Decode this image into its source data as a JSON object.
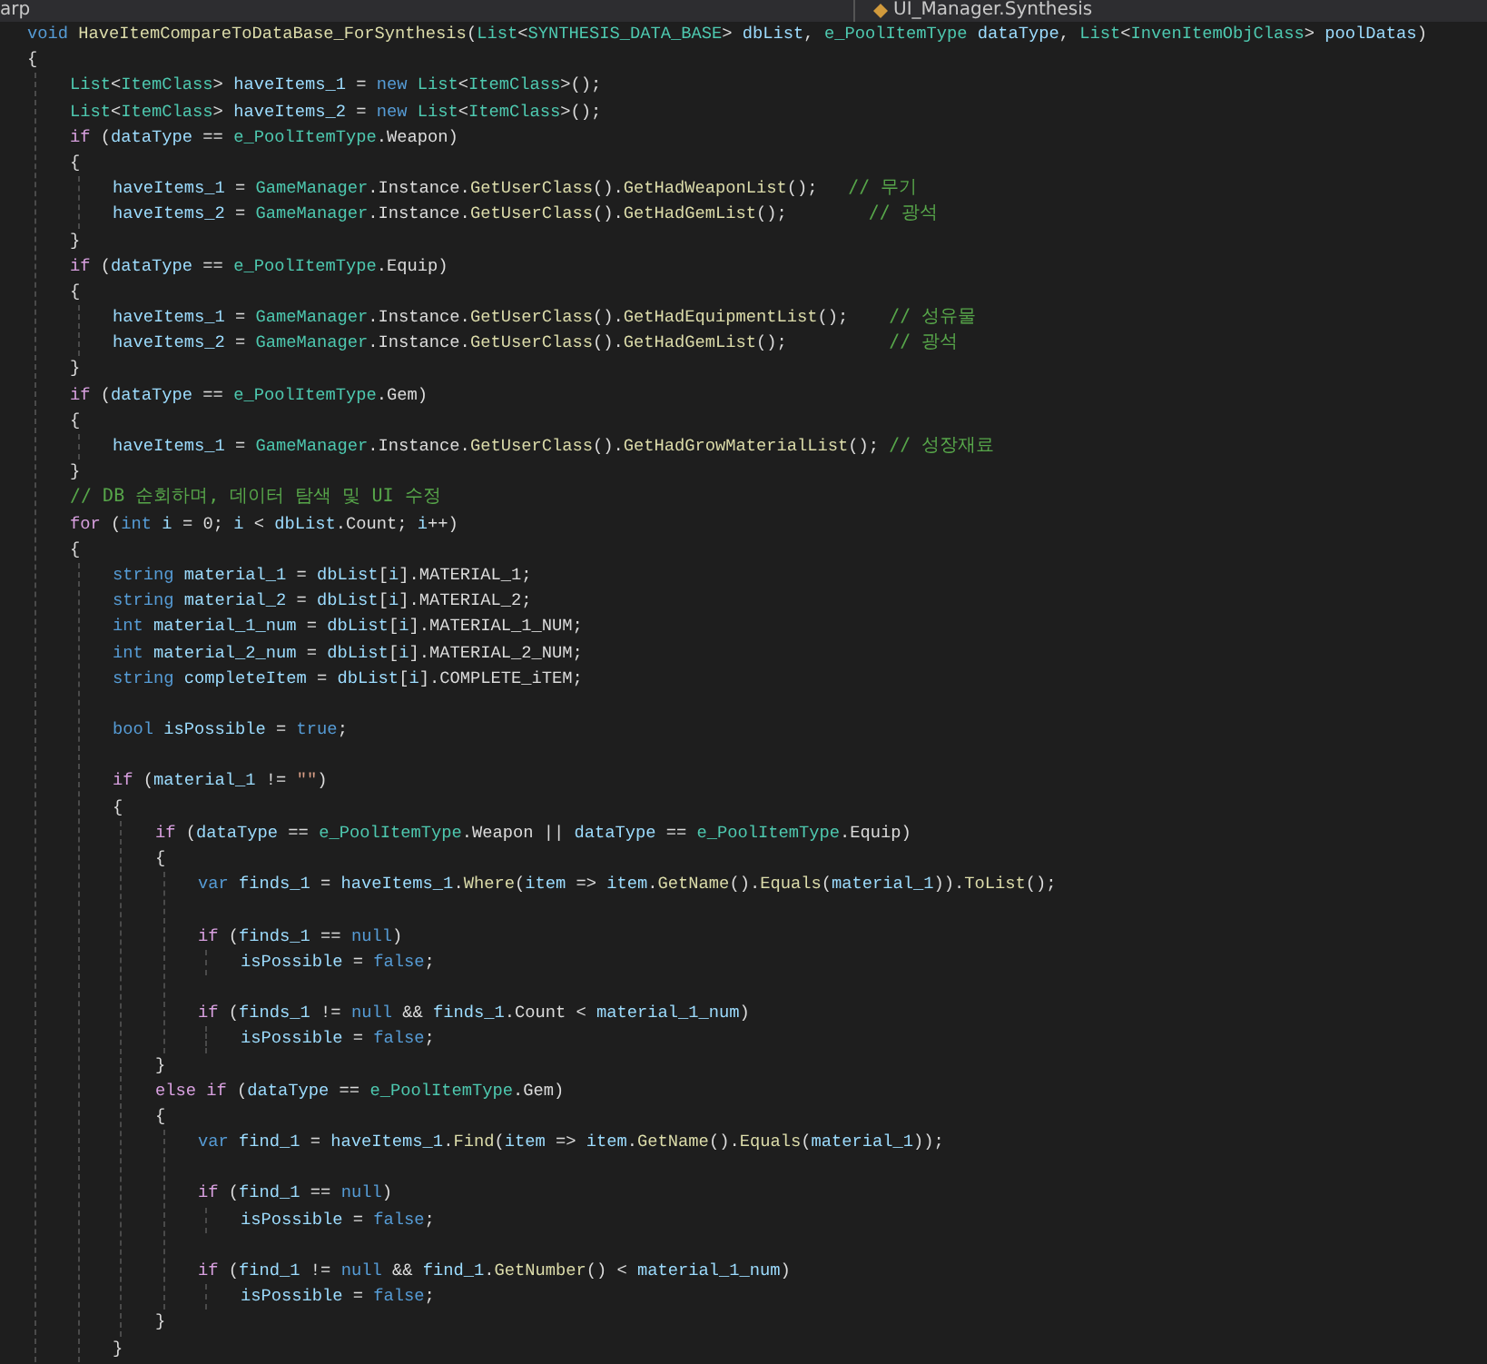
{
  "nav_bar": {
    "project": "arp",
    "member": "UI_Manager.Synthesis"
  },
  "code": [
    {
      "kind": "code",
      "tokens": [
        {
          "kind": "kw",
          "text": "void "
        },
        {
          "kind": "fn",
          "text": "HaveItemCompareToDataBase_ForSynthesis"
        },
        {
          "kind": "txt",
          "text": "("
        },
        {
          "kind": "type",
          "text": "List"
        },
        {
          "kind": "txt",
          "text": "<"
        },
        {
          "kind": "type",
          "text": "SYNTHESIS_DATA_BASE"
        },
        {
          "kind": "txt",
          "text": "> "
        },
        {
          "kind": "var",
          "text": "dbList"
        },
        {
          "kind": "txt",
          "text": ", "
        },
        {
          "kind": "type",
          "text": "e_PoolItemType "
        },
        {
          "kind": "var",
          "text": "dataType"
        },
        {
          "kind": "txt",
          "text": ", "
        },
        {
          "kind": "type",
          "text": "List"
        },
        {
          "kind": "txt",
          "text": "<"
        },
        {
          "kind": "type",
          "text": "InvenItemObjClass"
        },
        {
          "kind": "txt",
          "text": "> "
        },
        {
          "kind": "var",
          "text": "poolDatas"
        },
        {
          "kind": "txt",
          "text": ")"
        }
      ]
    },
    {
      "kind": "code",
      "tokens": [
        {
          "kind": "txt",
          "text": "{"
        }
      ],
      "children": [
        {
          "kind": "code",
          "tokens": [
            {
              "kind": "type",
              "text": "List"
            },
            {
              "kind": "txt",
              "text": "<"
            },
            {
              "kind": "type",
              "text": "ItemClass"
            },
            {
              "kind": "txt",
              "text": "> "
            },
            {
              "kind": "var",
              "text": "haveItems_1"
            },
            {
              "kind": "txt",
              "text": " = "
            },
            {
              "kind": "kw",
              "text": "new "
            },
            {
              "kind": "type",
              "text": "List"
            },
            {
              "kind": "txt",
              "text": "<"
            },
            {
              "kind": "type",
              "text": "ItemClass"
            },
            {
              "kind": "txt",
              "text": ">();"
            }
          ]
        },
        {
          "kind": "code",
          "tokens": [
            {
              "kind": "type",
              "text": "List"
            },
            {
              "kind": "txt",
              "text": "<"
            },
            {
              "kind": "type",
              "text": "ItemClass"
            },
            {
              "kind": "txt",
              "text": "> "
            },
            {
              "kind": "var",
              "text": "haveItems_2"
            },
            {
              "kind": "txt",
              "text": " = "
            },
            {
              "kind": "kw",
              "text": "new "
            },
            {
              "kind": "type",
              "text": "List"
            },
            {
              "kind": "txt",
              "text": "<"
            },
            {
              "kind": "type",
              "text": "ItemClass"
            },
            {
              "kind": "txt",
              "text": ">();"
            }
          ]
        },
        {
          "kind": "code",
          "tokens": [
            {
              "kind": "ctl",
              "text": "if "
            },
            {
              "kind": "txt",
              "text": "("
            },
            {
              "kind": "var",
              "text": "dataType"
            },
            {
              "kind": "txt",
              "text": " == "
            },
            {
              "kind": "type",
              "text": "e_PoolItemType"
            },
            {
              "kind": "txt",
              "text": ".Weapon)"
            }
          ]
        },
        {
          "kind": "code",
          "tokens": [
            {
              "kind": "txt",
              "text": "{"
            }
          ],
          "children": [
            {
              "kind": "code",
              "tokens": [
                {
                  "kind": "var",
                  "text": "haveItems_1"
                },
                {
                  "kind": "txt",
                  "text": " = "
                },
                {
                  "kind": "type",
                  "text": "GameManager"
                },
                {
                  "kind": "txt",
                  "text": ".Instance."
                },
                {
                  "kind": "fn",
                  "text": "GetUserClass"
                },
                {
                  "kind": "txt",
                  "text": "()."
                },
                {
                  "kind": "fn",
                  "text": "GetHadWeaponList"
                },
                {
                  "kind": "txt",
                  "text": "();   "
                },
                {
                  "kind": "cmt",
                  "text": "// 무기"
                }
              ]
            },
            {
              "kind": "code",
              "tokens": [
                {
                  "kind": "var",
                  "text": "haveItems_2"
                },
                {
                  "kind": "txt",
                  "text": " = "
                },
                {
                  "kind": "type",
                  "text": "GameManager"
                },
                {
                  "kind": "txt",
                  "text": ".Instance."
                },
                {
                  "kind": "fn",
                  "text": "GetUserClass"
                },
                {
                  "kind": "txt",
                  "text": "()."
                },
                {
                  "kind": "fn",
                  "text": "GetHadGemList"
                },
                {
                  "kind": "txt",
                  "text": "();        "
                },
                {
                  "kind": "cmt",
                  "text": "// 광석"
                }
              ]
            }
          ]
        },
        {
          "kind": "code",
          "tokens": [
            {
              "kind": "txt",
              "text": "}"
            }
          ]
        },
        {
          "kind": "code",
          "tokens": [
            {
              "kind": "ctl",
              "text": "if "
            },
            {
              "kind": "txt",
              "text": "("
            },
            {
              "kind": "var",
              "text": "dataType"
            },
            {
              "kind": "txt",
              "text": " == "
            },
            {
              "kind": "type",
              "text": "e_PoolItemType"
            },
            {
              "kind": "txt",
              "text": ".Equip)"
            }
          ]
        },
        {
          "kind": "code",
          "tokens": [
            {
              "kind": "txt",
              "text": "{"
            }
          ],
          "children": [
            {
              "kind": "code",
              "tokens": [
                {
                  "kind": "var",
                  "text": "haveItems_1"
                },
                {
                  "kind": "txt",
                  "text": " = "
                },
                {
                  "kind": "type",
                  "text": "GameManager"
                },
                {
                  "kind": "txt",
                  "text": ".Instance."
                },
                {
                  "kind": "fn",
                  "text": "GetUserClass"
                },
                {
                  "kind": "txt",
                  "text": "()."
                },
                {
                  "kind": "fn",
                  "text": "GetHadEquipmentList"
                },
                {
                  "kind": "txt",
                  "text": "();    "
                },
                {
                  "kind": "cmt",
                  "text": "// 성유물"
                }
              ]
            },
            {
              "kind": "code",
              "tokens": [
                {
                  "kind": "var",
                  "text": "haveItems_2"
                },
                {
                  "kind": "txt",
                  "text": " = "
                },
                {
                  "kind": "type",
                  "text": "GameManager"
                },
                {
                  "kind": "txt",
                  "text": ".Instance."
                },
                {
                  "kind": "fn",
                  "text": "GetUserClass"
                },
                {
                  "kind": "txt",
                  "text": "()."
                },
                {
                  "kind": "fn",
                  "text": "GetHadGemList"
                },
                {
                  "kind": "txt",
                  "text": "();          "
                },
                {
                  "kind": "cmt",
                  "text": "// 광석"
                }
              ]
            }
          ]
        },
        {
          "kind": "code",
          "tokens": [
            {
              "kind": "txt",
              "text": "}"
            }
          ]
        },
        {
          "kind": "code",
          "tokens": [
            {
              "kind": "ctl",
              "text": "if "
            },
            {
              "kind": "txt",
              "text": "("
            },
            {
              "kind": "var",
              "text": "dataType"
            },
            {
              "kind": "txt",
              "text": " == "
            },
            {
              "kind": "type",
              "text": "e_PoolItemType"
            },
            {
              "kind": "txt",
              "text": ".Gem)"
            }
          ]
        },
        {
          "kind": "code",
          "tokens": [
            {
              "kind": "txt",
              "text": "{"
            }
          ],
          "children": [
            {
              "kind": "code",
              "tokens": [
                {
                  "kind": "var",
                  "text": "haveItems_1"
                },
                {
                  "kind": "txt",
                  "text": " = "
                },
                {
                  "kind": "type",
                  "text": "GameManager"
                },
                {
                  "kind": "txt",
                  "text": ".Instance."
                },
                {
                  "kind": "fn",
                  "text": "GetUserClass"
                },
                {
                  "kind": "txt",
                  "text": "()."
                },
                {
                  "kind": "fn",
                  "text": "GetHadGrowMaterialList"
                },
                {
                  "kind": "txt",
                  "text": "(); "
                },
                {
                  "kind": "cmt",
                  "text": "// 성장재료"
                }
              ]
            }
          ]
        },
        {
          "kind": "code",
          "tokens": [
            {
              "kind": "txt",
              "text": "}"
            }
          ]
        },
        {
          "kind": "code",
          "tokens": [
            {
              "kind": "cmt",
              "text": "// DB 순회하며, 데이터 탐색 및 UI 수정"
            }
          ]
        },
        {
          "kind": "code",
          "tokens": [
            {
              "kind": "ctl",
              "text": "for "
            },
            {
              "kind": "txt",
              "text": "("
            },
            {
              "kind": "kw",
              "text": "int "
            },
            {
              "kind": "var",
              "text": "i"
            },
            {
              "kind": "txt",
              "text": " = 0; "
            },
            {
              "kind": "var",
              "text": "i"
            },
            {
              "kind": "txt",
              "text": " < "
            },
            {
              "kind": "var",
              "text": "dbList"
            },
            {
              "kind": "txt",
              "text": ".Count; "
            },
            {
              "kind": "var",
              "text": "i"
            },
            {
              "kind": "txt",
              "text": "++)"
            }
          ]
        },
        {
          "kind": "code",
          "tokens": [
            {
              "kind": "txt",
              "text": "{"
            }
          ],
          "children": [
            {
              "kind": "code",
              "tokens": [
                {
                  "kind": "kw",
                  "text": "string "
                },
                {
                  "kind": "var",
                  "text": "material_1"
                },
                {
                  "kind": "txt",
                  "text": " = "
                },
                {
                  "kind": "var",
                  "text": "dbList"
                },
                {
                  "kind": "txt",
                  "text": "["
                },
                {
                  "kind": "var",
                  "text": "i"
                },
                {
                  "kind": "txt",
                  "text": "].MATERIAL_1;"
                }
              ]
            },
            {
              "kind": "code",
              "tokens": [
                {
                  "kind": "kw",
                  "text": "string "
                },
                {
                  "kind": "var",
                  "text": "material_2"
                },
                {
                  "kind": "txt",
                  "text": " = "
                },
                {
                  "kind": "var",
                  "text": "dbList"
                },
                {
                  "kind": "txt",
                  "text": "["
                },
                {
                  "kind": "var",
                  "text": "i"
                },
                {
                  "kind": "txt",
                  "text": "].MATERIAL_2;"
                }
              ]
            },
            {
              "kind": "code",
              "tokens": [
                {
                  "kind": "kw",
                  "text": "int "
                },
                {
                  "kind": "var",
                  "text": "material_1_num"
                },
                {
                  "kind": "txt",
                  "text": " = "
                },
                {
                  "kind": "var",
                  "text": "dbList"
                },
                {
                  "kind": "txt",
                  "text": "["
                },
                {
                  "kind": "var",
                  "text": "i"
                },
                {
                  "kind": "txt",
                  "text": "].MATERIAL_1_NUM;"
                }
              ]
            },
            {
              "kind": "code",
              "tokens": [
                {
                  "kind": "kw",
                  "text": "int "
                },
                {
                  "kind": "var",
                  "text": "material_2_num"
                },
                {
                  "kind": "txt",
                  "text": " = "
                },
                {
                  "kind": "var",
                  "text": "dbList"
                },
                {
                  "kind": "txt",
                  "text": "["
                },
                {
                  "kind": "var",
                  "text": "i"
                },
                {
                  "kind": "txt",
                  "text": "].MATERIAL_2_NUM;"
                }
              ]
            },
            {
              "kind": "code",
              "tokens": [
                {
                  "kind": "kw",
                  "text": "string "
                },
                {
                  "kind": "var",
                  "text": "completeItem"
                },
                {
                  "kind": "txt",
                  "text": " = "
                },
                {
                  "kind": "var",
                  "text": "dbList"
                },
                {
                  "kind": "txt",
                  "text": "["
                },
                {
                  "kind": "var",
                  "text": "i"
                },
                {
                  "kind": "txt",
                  "text": "].COMPLETE_iTEM;"
                }
              ]
            },
            {
              "kind": "blank"
            },
            {
              "kind": "code",
              "tokens": [
                {
                  "kind": "kw",
                  "text": "bool "
                },
                {
                  "kind": "var",
                  "text": "isPossible"
                },
                {
                  "kind": "txt",
                  "text": " = "
                },
                {
                  "kind": "kw",
                  "text": "true"
                },
                {
                  "kind": "txt",
                  "text": ";"
                }
              ]
            },
            {
              "kind": "blank"
            },
            {
              "kind": "code",
              "tokens": [
                {
                  "kind": "ctl",
                  "text": "if "
                },
                {
                  "kind": "txt",
                  "text": "("
                },
                {
                  "kind": "var",
                  "text": "material_1"
                },
                {
                  "kind": "txt",
                  "text": " != "
                },
                {
                  "kind": "str",
                  "text": "\"\""
                },
                {
                  "kind": "txt",
                  "text": ")"
                }
              ]
            },
            {
              "kind": "code",
              "tokens": [
                {
                  "kind": "txt",
                  "text": "{"
                }
              ],
              "children": [
                {
                  "kind": "code",
                  "tokens": [
                    {
                      "kind": "ctl",
                      "text": "if "
                    },
                    {
                      "kind": "txt",
                      "text": "("
                    },
                    {
                      "kind": "var",
                      "text": "dataType"
                    },
                    {
                      "kind": "txt",
                      "text": " == "
                    },
                    {
                      "kind": "type",
                      "text": "e_PoolItemType"
                    },
                    {
                      "kind": "txt",
                      "text": ".Weapon || "
                    },
                    {
                      "kind": "var",
                      "text": "dataType"
                    },
                    {
                      "kind": "txt",
                      "text": " == "
                    },
                    {
                      "kind": "type",
                      "text": "e_PoolItemType"
                    },
                    {
                      "kind": "txt",
                      "text": ".Equip)"
                    }
                  ]
                },
                {
                  "kind": "code",
                  "tokens": [
                    {
                      "kind": "txt",
                      "text": "{"
                    }
                  ],
                  "children": [
                    {
                      "kind": "code",
                      "tokens": [
                        {
                          "kind": "kw",
                          "text": "var "
                        },
                        {
                          "kind": "var",
                          "text": "finds_1"
                        },
                        {
                          "kind": "txt",
                          "text": " = "
                        },
                        {
                          "kind": "var",
                          "text": "haveItems_1"
                        },
                        {
                          "kind": "txt",
                          "text": "."
                        },
                        {
                          "kind": "fn",
                          "text": "Where"
                        },
                        {
                          "kind": "txt",
                          "text": "("
                        },
                        {
                          "kind": "var",
                          "text": "item"
                        },
                        {
                          "kind": "txt",
                          "text": " => "
                        },
                        {
                          "kind": "var",
                          "text": "item"
                        },
                        {
                          "kind": "txt",
                          "text": "."
                        },
                        {
                          "kind": "fn",
                          "text": "GetName"
                        },
                        {
                          "kind": "txt",
                          "text": "()."
                        },
                        {
                          "kind": "fn",
                          "text": "Equals"
                        },
                        {
                          "kind": "txt",
                          "text": "("
                        },
                        {
                          "kind": "var",
                          "text": "material_1"
                        },
                        {
                          "kind": "txt",
                          "text": "))."
                        },
                        {
                          "kind": "fn",
                          "text": "ToList"
                        },
                        {
                          "kind": "txt",
                          "text": "();"
                        }
                      ]
                    },
                    {
                      "kind": "blank"
                    },
                    {
                      "kind": "code",
                      "tokens": [
                        {
                          "kind": "ctl",
                          "text": "if "
                        },
                        {
                          "kind": "txt",
                          "text": "("
                        },
                        {
                          "kind": "var",
                          "text": "finds_1"
                        },
                        {
                          "kind": "txt",
                          "text": " == "
                        },
                        {
                          "kind": "kw",
                          "text": "null"
                        },
                        {
                          "kind": "txt",
                          "text": ")"
                        }
                      ],
                      "children": [
                        {
                          "kind": "code",
                          "tokens": [
                            {
                              "kind": "var",
                              "text": "isPossible"
                            },
                            {
                              "kind": "txt",
                              "text": " = "
                            },
                            {
                              "kind": "kw",
                              "text": "false"
                            },
                            {
                              "kind": "txt",
                              "text": ";"
                            }
                          ]
                        }
                      ]
                    },
                    {
                      "kind": "blank"
                    },
                    {
                      "kind": "code",
                      "tokens": [
                        {
                          "kind": "ctl",
                          "text": "if "
                        },
                        {
                          "kind": "txt",
                          "text": "("
                        },
                        {
                          "kind": "var",
                          "text": "finds_1"
                        },
                        {
                          "kind": "txt",
                          "text": " != "
                        },
                        {
                          "kind": "kw",
                          "text": "null"
                        },
                        {
                          "kind": "txt",
                          "text": " && "
                        },
                        {
                          "kind": "var",
                          "text": "finds_1"
                        },
                        {
                          "kind": "txt",
                          "text": ".Count < "
                        },
                        {
                          "kind": "var",
                          "text": "material_1_num"
                        },
                        {
                          "kind": "txt",
                          "text": ")"
                        }
                      ],
                      "children": [
                        {
                          "kind": "code",
                          "tokens": [
                            {
                              "kind": "var",
                              "text": "isPossible"
                            },
                            {
                              "kind": "txt",
                              "text": " = "
                            },
                            {
                              "kind": "kw",
                              "text": "false"
                            },
                            {
                              "kind": "txt",
                              "text": ";"
                            }
                          ]
                        }
                      ]
                    }
                  ]
                },
                {
                  "kind": "code",
                  "tokens": [
                    {
                      "kind": "txt",
                      "text": "}"
                    }
                  ]
                },
                {
                  "kind": "code",
                  "tokens": [
                    {
                      "kind": "ctl",
                      "text": "else if "
                    },
                    {
                      "kind": "txt",
                      "text": "("
                    },
                    {
                      "kind": "var",
                      "text": "dataType"
                    },
                    {
                      "kind": "txt",
                      "text": " == "
                    },
                    {
                      "kind": "type",
                      "text": "e_PoolItemType"
                    },
                    {
                      "kind": "txt",
                      "text": ".Gem)"
                    }
                  ]
                },
                {
                  "kind": "code",
                  "tokens": [
                    {
                      "kind": "txt",
                      "text": "{"
                    }
                  ],
                  "children": [
                    {
                      "kind": "code",
                      "tokens": [
                        {
                          "kind": "kw",
                          "text": "var "
                        },
                        {
                          "kind": "var",
                          "text": "find_1"
                        },
                        {
                          "kind": "txt",
                          "text": " = "
                        },
                        {
                          "kind": "var",
                          "text": "haveItems_1"
                        },
                        {
                          "kind": "txt",
                          "text": "."
                        },
                        {
                          "kind": "fn",
                          "text": "Find"
                        },
                        {
                          "kind": "txt",
                          "text": "("
                        },
                        {
                          "kind": "var",
                          "text": "item"
                        },
                        {
                          "kind": "txt",
                          "text": " => "
                        },
                        {
                          "kind": "var",
                          "text": "item"
                        },
                        {
                          "kind": "txt",
                          "text": "."
                        },
                        {
                          "kind": "fn",
                          "text": "GetName"
                        },
                        {
                          "kind": "txt",
                          "text": "()."
                        },
                        {
                          "kind": "fn",
                          "text": "Equals"
                        },
                        {
                          "kind": "txt",
                          "text": "("
                        },
                        {
                          "kind": "var",
                          "text": "material_1"
                        },
                        {
                          "kind": "txt",
                          "text": "));"
                        }
                      ]
                    },
                    {
                      "kind": "blank"
                    },
                    {
                      "kind": "code",
                      "tokens": [
                        {
                          "kind": "ctl",
                          "text": "if "
                        },
                        {
                          "kind": "txt",
                          "text": "("
                        },
                        {
                          "kind": "var",
                          "text": "find_1"
                        },
                        {
                          "kind": "txt",
                          "text": " == "
                        },
                        {
                          "kind": "kw",
                          "text": "null"
                        },
                        {
                          "kind": "txt",
                          "text": ")"
                        }
                      ],
                      "children": [
                        {
                          "kind": "code",
                          "tokens": [
                            {
                              "kind": "var",
                              "text": "isPossible"
                            },
                            {
                              "kind": "txt",
                              "text": " = "
                            },
                            {
                              "kind": "kw",
                              "text": "false"
                            },
                            {
                              "kind": "txt",
                              "text": ";"
                            }
                          ]
                        }
                      ]
                    },
                    {
                      "kind": "blank"
                    },
                    {
                      "kind": "code",
                      "tokens": [
                        {
                          "kind": "ctl",
                          "text": "if "
                        },
                        {
                          "kind": "txt",
                          "text": "("
                        },
                        {
                          "kind": "var",
                          "text": "find_1"
                        },
                        {
                          "kind": "txt",
                          "text": " != "
                        },
                        {
                          "kind": "kw",
                          "text": "null"
                        },
                        {
                          "kind": "txt",
                          "text": " && "
                        },
                        {
                          "kind": "var",
                          "text": "find_1"
                        },
                        {
                          "kind": "txt",
                          "text": "."
                        },
                        {
                          "kind": "fn",
                          "text": "GetNumber"
                        },
                        {
                          "kind": "txt",
                          "text": "() < "
                        },
                        {
                          "kind": "var",
                          "text": "material_1_num"
                        },
                        {
                          "kind": "txt",
                          "text": ")"
                        }
                      ],
                      "children": [
                        {
                          "kind": "code",
                          "tokens": [
                            {
                              "kind": "var",
                              "text": "isPossible"
                            },
                            {
                              "kind": "txt",
                              "text": " = "
                            },
                            {
                              "kind": "kw",
                              "text": "false"
                            },
                            {
                              "kind": "txt",
                              "text": ";"
                            }
                          ]
                        }
                      ]
                    }
                  ]
                },
                {
                  "kind": "code",
                  "tokens": [
                    {
                      "kind": "txt",
                      "text": "}"
                    }
                  ]
                }
              ]
            },
            {
              "kind": "code",
              "tokens": [
                {
                  "kind": "txt",
                  "text": "}"
                }
              ]
            }
          ]
        }
      ]
    }
  ]
}
